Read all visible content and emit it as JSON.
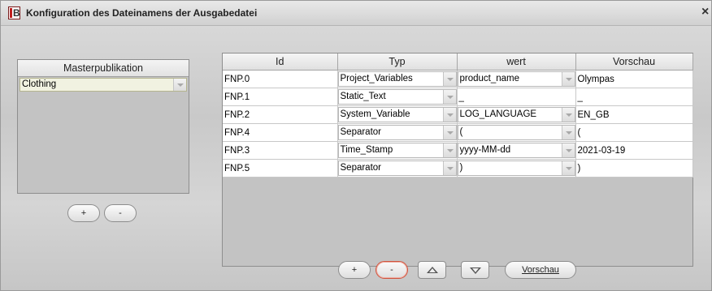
{
  "window": {
    "title": "Konfiguration des Dateinamens der Ausgabedatei",
    "close_glyph": "×",
    "icon": "app-logo-icon",
    "icon_letter": "B"
  },
  "left_panel": {
    "header": "Masterpublikation",
    "selected_value": "Clothing",
    "add_label": "+",
    "remove_label": "-"
  },
  "table": {
    "columns": [
      "Id",
      "Typ",
      "wert",
      "Vorschau"
    ],
    "rows": [
      {
        "id": "FNP.0",
        "typ": "Project_Variables",
        "wert": "product_name",
        "vorschau": "Olympas"
      },
      {
        "id": "FNP.1",
        "typ": "Static_Text",
        "wert": "_",
        "vorschau": "_"
      },
      {
        "id": "FNP.2",
        "typ": "System_Variable",
        "wert": "LOG_LANGUAGE",
        "vorschau": "EN_GB"
      },
      {
        "id": "FNP.4",
        "typ": "Separator",
        "wert": "(",
        "vorschau": "("
      },
      {
        "id": "FNP.3",
        "typ": "Time_Stamp",
        "wert": "yyyy-MM-dd",
        "vorschau": "2021-03-19"
      },
      {
        "id": "FNP.5",
        "typ": "Separator",
        "wert": ")",
        "vorschau": ")"
      }
    ]
  },
  "bottom_toolbar": {
    "add_label": "+",
    "remove_label": "-",
    "up_icon": "move-up-icon",
    "down_icon": "move-down-icon",
    "preview_label": "Vorschau"
  },
  "colors": {
    "active_border": "#d0533d",
    "master_combo_bg": "#f1f2e1"
  }
}
